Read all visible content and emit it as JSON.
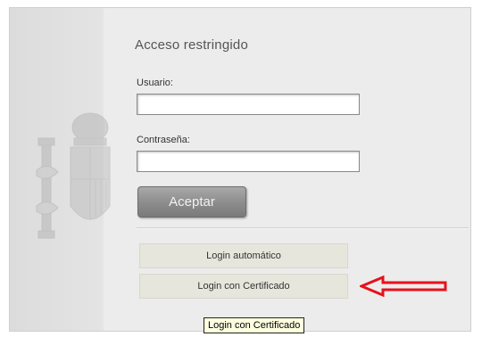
{
  "login": {
    "title": "Acceso restringido",
    "username_label": "Usuario:",
    "username_value": "",
    "password_label": "Contraseña:",
    "password_value": "",
    "accept_label": "Aceptar"
  },
  "alt_login": {
    "automatic_label": "Login automático",
    "certificate_label": "Login con Certificado"
  },
  "tooltip": {
    "text": "Login con Certificado"
  },
  "annotation": {
    "arrow_color": "#e8101a",
    "icon": "left-arrow-icon"
  },
  "decor": {
    "crest_icon": "coat-of-arms-icon"
  }
}
